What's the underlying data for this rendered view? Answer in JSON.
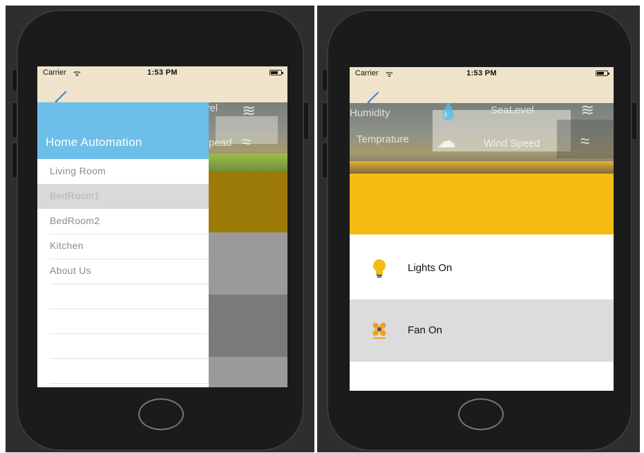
{
  "left": {
    "status": {
      "carrier": "Carrier",
      "time": "1:53 PM"
    },
    "background_labels": {
      "sea_level_fragment": "vel",
      "wind_speed_fragment": "Spead"
    },
    "drawer": {
      "title": "Home Automation",
      "items": [
        {
          "label": "Living Room",
          "selected": false
        },
        {
          "label": "BedRoom1",
          "selected": true
        },
        {
          "label": "BedRoom2",
          "selected": false
        },
        {
          "label": "Kitchen",
          "selected": false
        },
        {
          "label": "About Us",
          "selected": false
        }
      ]
    }
  },
  "right": {
    "status": {
      "carrier": "Carrier",
      "time": "1:53 PM"
    },
    "weather": {
      "humidity_label": "Humidity",
      "sea_level_label": "SeaLevel",
      "temperature_label": "Temprature",
      "wind_speed_label": "Wind Speed"
    },
    "controls": [
      {
        "label": "Lights On",
        "icon": "light-bulb-icon"
      },
      {
        "label": "Fan On",
        "icon": "fan-icon"
      }
    ]
  },
  "colors": {
    "navbar": "#efe4cb",
    "drawer_header": "#6dbfea",
    "accent_yellow": "#f6bb12",
    "selected_row": "#d9d9d9",
    "back_arrow": "#2f7fd6"
  }
}
